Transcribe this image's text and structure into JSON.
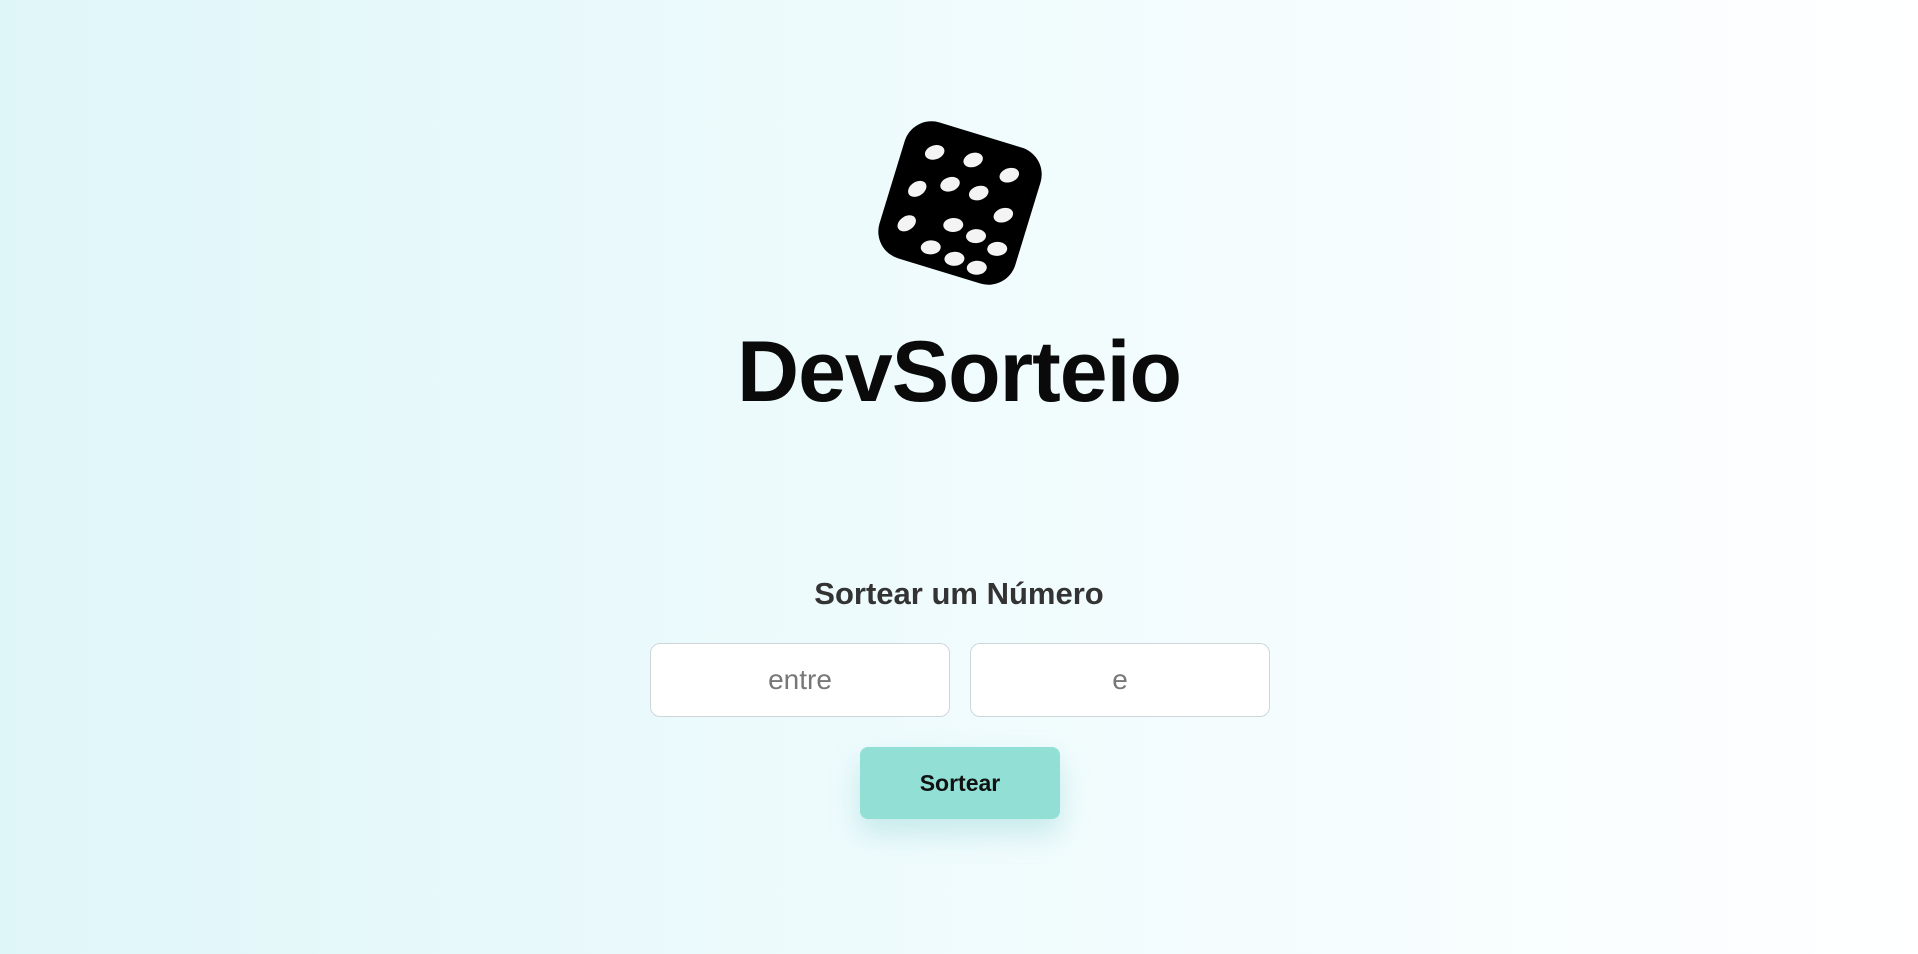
{
  "app": {
    "title": "DevSorteio",
    "logo_icon": "dice-icon"
  },
  "draw_form": {
    "heading": "Sortear um Número",
    "from_input": {
      "placeholder": "entre",
      "value": ""
    },
    "to_input": {
      "placeholder": "e",
      "value": ""
    },
    "submit_label": "Sortear"
  },
  "colors": {
    "background_start": "#dff6f8",
    "background_end": "#ffffff",
    "button_accent": "#92e0d5",
    "title_text": "#0a0a0a"
  }
}
